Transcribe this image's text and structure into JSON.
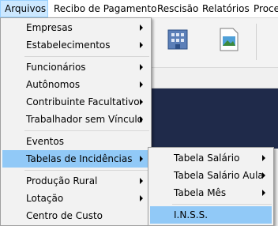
{
  "menubar": {
    "items": [
      "Arquivos",
      "Recibo de Pagamento",
      "Rescisão",
      "Relatórios",
      "Proce"
    ]
  },
  "menu": {
    "items": [
      {
        "label": "Empresas",
        "submenu": true
      },
      {
        "label": "Estabelecimentos",
        "submenu": true
      },
      {
        "label": "Funcionários",
        "submenu": true
      },
      {
        "label": "Autônomos",
        "submenu": true
      },
      {
        "label": "Contribuinte Facultativo",
        "submenu": true
      },
      {
        "label": "Trabalhador sem Vínculo",
        "submenu": true
      },
      {
        "label": "Eventos",
        "submenu": false
      },
      {
        "label": "Tabelas de Incidências",
        "submenu": true,
        "highlighted": true
      },
      {
        "label": "Produção Rural",
        "submenu": true
      },
      {
        "label": "Lotação",
        "submenu": true
      },
      {
        "label": "Centro de Custo",
        "submenu": false
      }
    ]
  },
  "submenu": {
    "items": [
      {
        "label": "Tabela Salário",
        "submenu": true
      },
      {
        "label": "Tabela Salário Aula",
        "submenu": true
      },
      {
        "label": "Tabela Mês",
        "submenu": true
      },
      {
        "label": "I.N.S.S.",
        "submenu": false,
        "highlighted": true
      }
    ]
  },
  "colors": {
    "highlight": "#91c9f7",
    "menubar_active": "#cce8ff",
    "dark_panel": "#1f2a4a"
  }
}
